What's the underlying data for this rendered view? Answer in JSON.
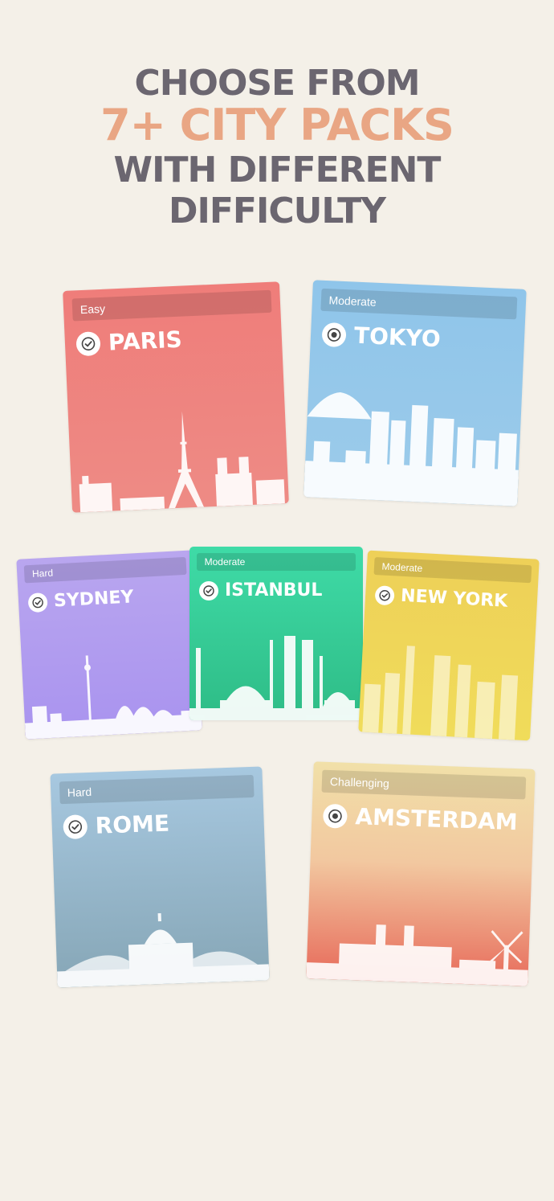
{
  "headline": {
    "line1": "CHOOSE FROM",
    "line2": "7+ CITY PACKS",
    "line3": "WITH DIFFERENT DIFFICULTY"
  },
  "cards": {
    "paris": {
      "difficulty": "Easy",
      "name": "PARIS",
      "status_icon": "check-circle-icon",
      "color_top": "#ef7d7a",
      "color_bottom": "#ee8b85"
    },
    "tokyo": {
      "difficulty": "Moderate",
      "name": "TOKYO",
      "status_icon": "target-circle-icon",
      "color_top": "#8fc5ea",
      "color_bottom": "#9ccbea"
    },
    "sydney": {
      "difficulty": "Hard",
      "name": "SYDNEY",
      "status_icon": "check-circle-icon",
      "color_top": "#b9a6ef",
      "color_bottom": "#a993ef"
    },
    "istanbul": {
      "difficulty": "Moderate",
      "name": "ISTANBUL",
      "status_icon": "check-circle-icon",
      "color_top": "#3fdba7",
      "color_bottom": "#2ebc86"
    },
    "newyork": {
      "difficulty": "Moderate",
      "name": "NEW YORK",
      "status_icon": "check-circle-icon",
      "color_top": "#eed058",
      "color_bottom": "#f0dc5a"
    },
    "rome": {
      "difficulty": "Hard",
      "name": "ROME",
      "status_icon": "check-circle-icon",
      "color_top": "#a7c8e0",
      "color_bottom": "#86a6b6"
    },
    "amsterdam": {
      "difficulty": "Challenging",
      "name": "AMSTERDAM",
      "status_icon": "target-circle-icon",
      "color_top": "#f1e0a8",
      "color_bottom": "#e76a5a"
    }
  }
}
